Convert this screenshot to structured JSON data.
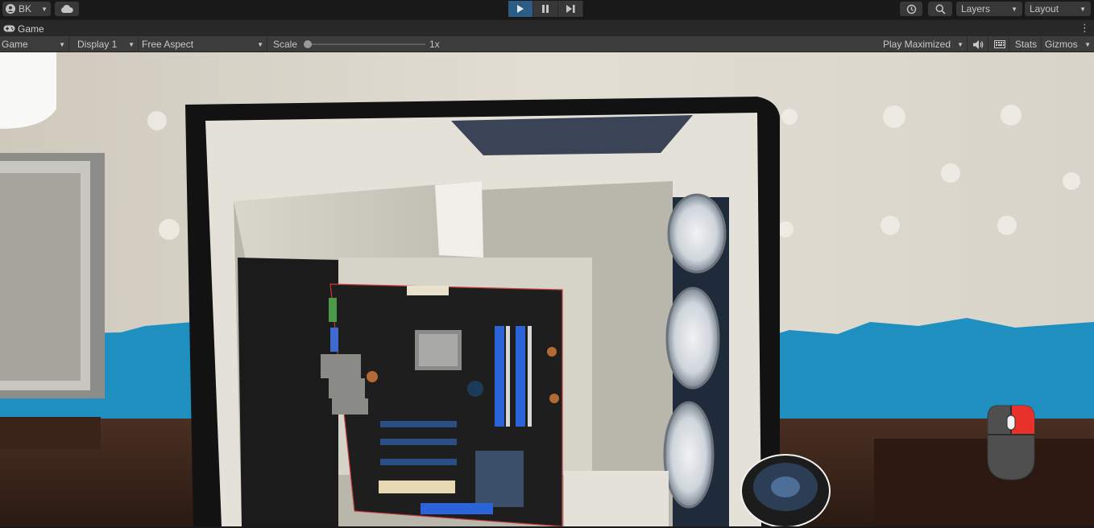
{
  "toolbar": {
    "account_label": "BK",
    "layers_label": "Layers",
    "layout_label": "Layout"
  },
  "tab": {
    "title": "Game"
  },
  "controls": {
    "view_dropdown": "Game",
    "display_dropdown": "Display 1",
    "aspect_dropdown": "Free Aspect",
    "scale_label": "Scale",
    "scale_value": "1x",
    "scale_level": 0.0,
    "play_mode_dropdown": "Play Maximized",
    "stats_label": "Stats",
    "gizmos_label": "Gizmos"
  },
  "play_state": {
    "playing": true
  },
  "colors": {
    "play_active": "#2c5d87",
    "wall": "#dedbd2",
    "wall_paint": "#1f8fc0",
    "case_white": "#e4e2d8",
    "motherboard": "#1e1e1e",
    "ram_slot": "#2b63d9",
    "mouse_highlight": "#e8312a"
  },
  "icons": [
    "account-icon",
    "cloud-icon",
    "play-icon",
    "pause-icon",
    "step-icon",
    "history-icon",
    "search-icon",
    "gamepad-icon",
    "kebab-menu-icon",
    "audio-mute-icon",
    "keyboard-icon",
    "mouse-right-click-icon"
  ]
}
